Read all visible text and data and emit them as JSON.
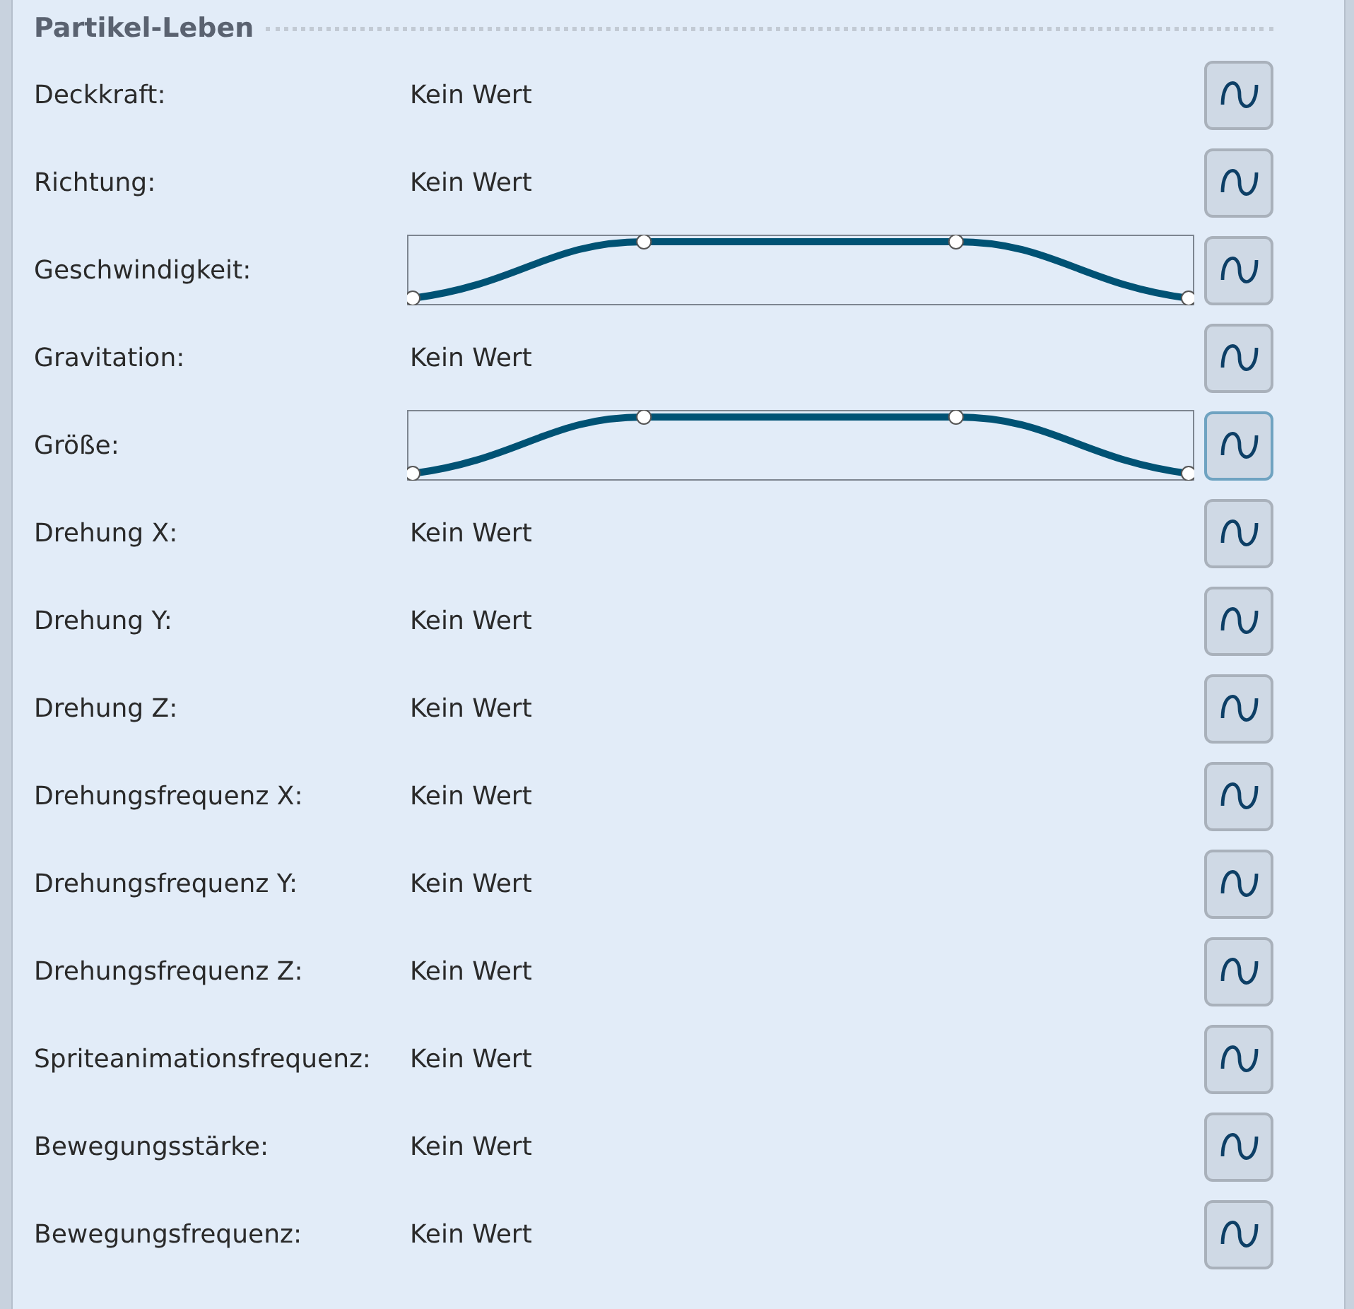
{
  "section": {
    "title": "Partikel-Leben"
  },
  "rows": [
    {
      "label": "Deckkraft:",
      "kind": "value",
      "value": "Kein Wert",
      "button_focused": false
    },
    {
      "label": "Richtung:",
      "kind": "value",
      "value": "Kein Wert",
      "button_focused": false
    },
    {
      "label": "Geschwindigkeit:",
      "kind": "curve",
      "button_focused": false
    },
    {
      "label": "Gravitation:",
      "kind": "value",
      "value": "Kein Wert",
      "button_focused": false
    },
    {
      "label": "Größe:",
      "kind": "curve",
      "button_focused": true
    },
    {
      "label": "Drehung X:",
      "kind": "value",
      "value": "Kein Wert",
      "button_focused": false
    },
    {
      "label": "Drehung Y:",
      "kind": "value",
      "value": "Kein Wert",
      "button_focused": false
    },
    {
      "label": "Drehung Z:",
      "kind": "value",
      "value": "Kein Wert",
      "button_focused": false
    },
    {
      "label": "Drehungsfrequenz X:",
      "kind": "value",
      "value": "Kein Wert",
      "button_focused": false
    },
    {
      "label": "Drehungsfrequenz Y:",
      "kind": "value",
      "value": "Kein Wert",
      "button_focused": false
    },
    {
      "label": "Drehungsfrequenz Z:",
      "kind": "value",
      "value": "Kein Wert",
      "button_focused": false
    },
    {
      "label": "Spriteanimationsfrequenz:",
      "kind": "value",
      "value": "Kein Wert",
      "button_focused": false
    },
    {
      "label": "Bewegungsstärke:",
      "kind": "value",
      "value": "Kein Wert",
      "button_focused": false
    },
    {
      "label": "Bewegungsfrequenz:",
      "kind": "value",
      "value": "Kein Wert",
      "button_focused": false
    }
  ]
}
